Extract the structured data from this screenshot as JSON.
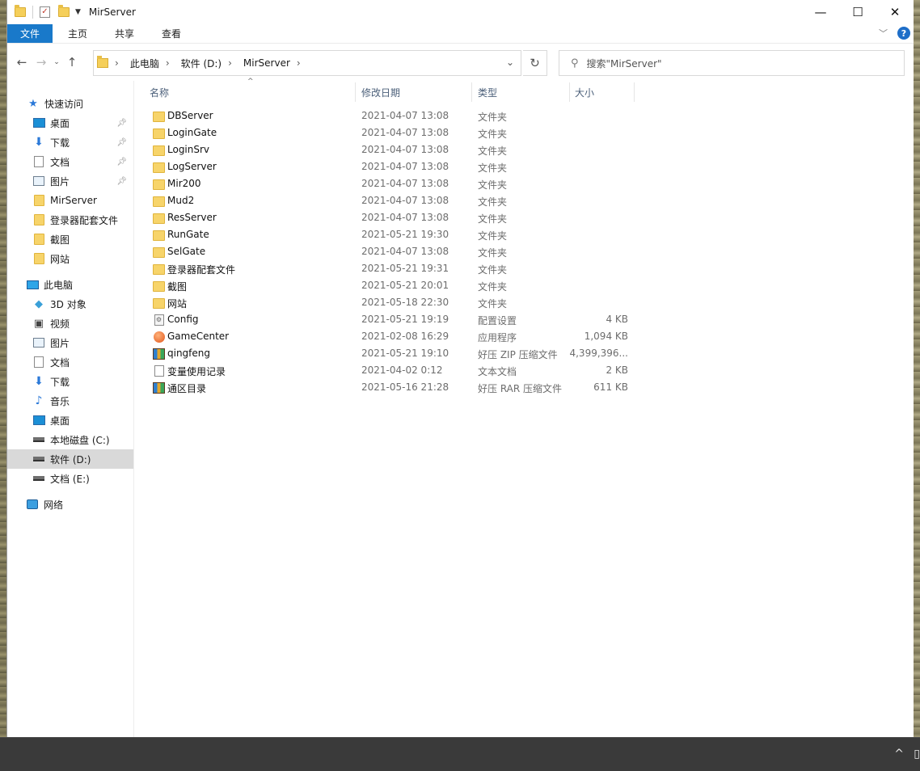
{
  "window": {
    "title": "MirServer",
    "minimize": "—",
    "maximize": "☐",
    "close": "✕"
  },
  "ribbon": {
    "file_tab": "文件",
    "tabs": [
      "主页",
      "共享",
      "查看"
    ],
    "help": "?",
    "expand": "﹀"
  },
  "nav": {
    "back": "←",
    "forward": "→",
    "recent": "⌄",
    "up": "↑",
    "refresh": "↻",
    "breadcrumb": [
      "此电脑",
      "软件 (D:)",
      "MirServer"
    ],
    "search_placeholder": "搜索\"MirServer\""
  },
  "sidebar": {
    "quick_access": "快速访问",
    "pinned": [
      {
        "label": "桌面",
        "icon": "desktop-icon"
      },
      {
        "label": "下载",
        "icon": "download-icon"
      },
      {
        "label": "文档",
        "icon": "document-icon"
      },
      {
        "label": "图片",
        "icon": "pictures-icon"
      }
    ],
    "recent": [
      "MirServer",
      "登录器配套文件",
      "截图",
      "网站"
    ],
    "this_pc": "此电脑",
    "pc_items": [
      {
        "label": "3D 对象",
        "icon": "3d-objects-icon"
      },
      {
        "label": "视频",
        "icon": "video-icon"
      },
      {
        "label": "图片",
        "icon": "pictures-icon"
      },
      {
        "label": "文档",
        "icon": "document-icon"
      },
      {
        "label": "下载",
        "icon": "download-icon"
      },
      {
        "label": "音乐",
        "icon": "music-icon"
      },
      {
        "label": "桌面",
        "icon": "desktop-icon"
      },
      {
        "label": "本地磁盘 (C:)",
        "icon": "drive-icon"
      },
      {
        "label": "软件 (D:)",
        "icon": "drive-icon"
      },
      {
        "label": "文档 (E:)",
        "icon": "drive-icon"
      }
    ],
    "network": "网络"
  },
  "columns": {
    "name": "名称",
    "date": "修改日期",
    "type": "类型",
    "size": "大小"
  },
  "files": [
    {
      "name": "DBServer",
      "date": "2021-04-07 13:08",
      "type": "文件夹",
      "size": "",
      "icon": "folder-icon"
    },
    {
      "name": "LoginGate",
      "date": "2021-04-07 13:08",
      "type": "文件夹",
      "size": "",
      "icon": "folder-icon"
    },
    {
      "name": "LoginSrv",
      "date": "2021-04-07 13:08",
      "type": "文件夹",
      "size": "",
      "icon": "folder-icon"
    },
    {
      "name": "LogServer",
      "date": "2021-04-07 13:08",
      "type": "文件夹",
      "size": "",
      "icon": "folder-icon"
    },
    {
      "name": "Mir200",
      "date": "2021-04-07 13:08",
      "type": "文件夹",
      "size": "",
      "icon": "folder-icon"
    },
    {
      "name": "Mud2",
      "date": "2021-04-07 13:08",
      "type": "文件夹",
      "size": "",
      "icon": "folder-icon"
    },
    {
      "name": "ResServer",
      "date": "2021-04-07 13:08",
      "type": "文件夹",
      "size": "",
      "icon": "folder-icon"
    },
    {
      "name": "RunGate",
      "date": "2021-05-21 19:30",
      "type": "文件夹",
      "size": "",
      "icon": "folder-icon"
    },
    {
      "name": "SelGate",
      "date": "2021-04-07 13:08",
      "type": "文件夹",
      "size": "",
      "icon": "folder-icon"
    },
    {
      "name": "登录器配套文件",
      "date": "2021-05-21 19:31",
      "type": "文件夹",
      "size": "",
      "icon": "folder-icon"
    },
    {
      "name": "截图",
      "date": "2021-05-21 20:01",
      "type": "文件夹",
      "size": "",
      "icon": "folder-icon"
    },
    {
      "name": "网站",
      "date": "2021-05-18 22:30",
      "type": "文件夹",
      "size": "",
      "icon": "folder-icon"
    },
    {
      "name": "Config",
      "date": "2021-05-21 19:19",
      "type": "配置设置",
      "size": "4 KB",
      "icon": "config-file-icon"
    },
    {
      "name": "GameCenter",
      "date": "2021-02-08 16:29",
      "type": "应用程序",
      "size": "1,094 KB",
      "icon": "application-icon"
    },
    {
      "name": "qingfeng",
      "date": "2021-05-21 19:10",
      "type": "好压 ZIP 压缩文件",
      "size": "4,399,396...",
      "icon": "archive-icon"
    },
    {
      "name": "变量使用记录",
      "date": "2021-04-02 0:12",
      "type": "文本文档",
      "size": "2 KB",
      "icon": "text-file-icon"
    },
    {
      "name": "通区目录",
      "date": "2021-05-16 21:28",
      "type": "好压 RAR 压缩文件",
      "size": "611 KB",
      "icon": "archive-icon"
    }
  ],
  "taskbar": {
    "tray_chevron": "^"
  }
}
